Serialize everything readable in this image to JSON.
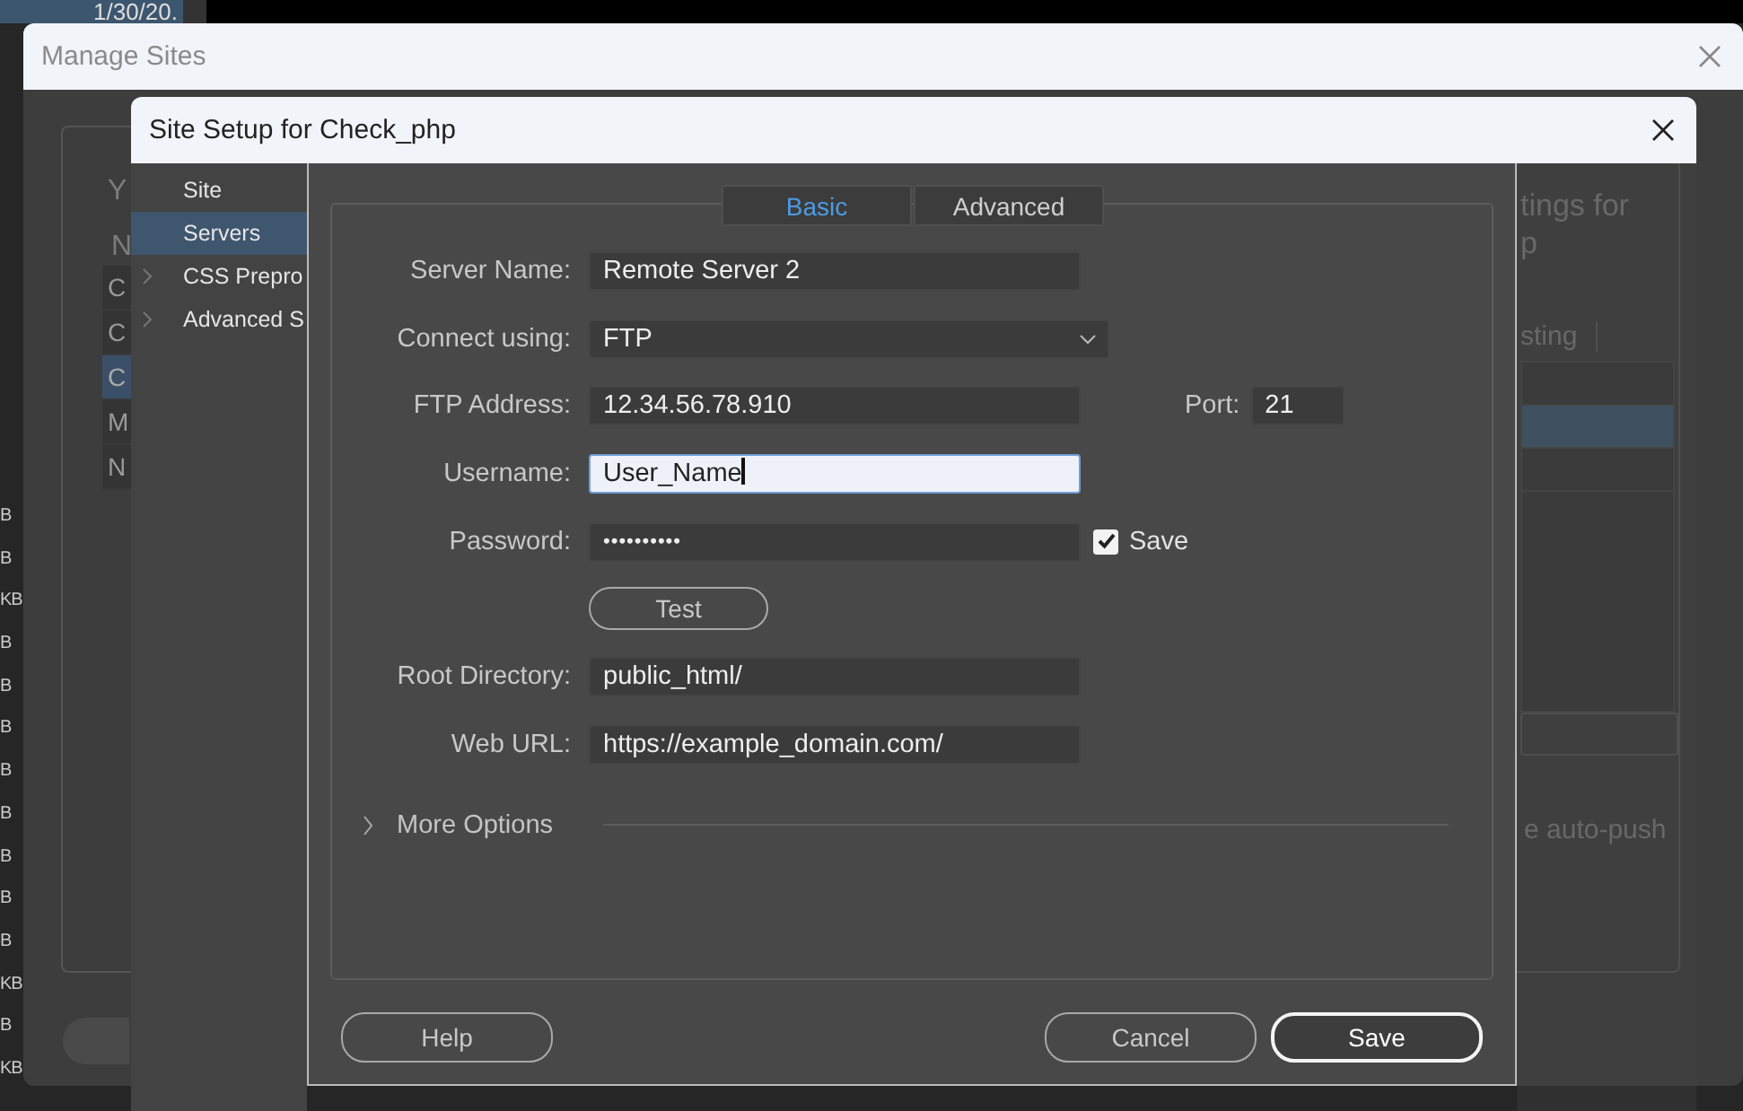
{
  "background": {
    "date_cell": "1/30/20.",
    "file_sizes": [
      "B",
      "B",
      "KB",
      "B",
      "B",
      "B",
      "B",
      "B",
      "B",
      "B",
      "B",
      "KB",
      "B",
      "KB"
    ]
  },
  "manage_sites": {
    "title": "Manage Sites",
    "heading_fragment": "Y",
    "column_fragment": "N",
    "site_list": [
      {
        "label": "C",
        "selected": false
      },
      {
        "label": "C",
        "selected": false
      },
      {
        "label": "C",
        "selected": true
      },
      {
        "label": "M",
        "selected": false
      },
      {
        "label": "N",
        "selected": false
      }
    ],
    "description_fragments": [
      "tings for",
      "p"
    ],
    "tab_fragment": "sting",
    "server_rows": [
      {
        "selected": false
      },
      {
        "selected": true
      },
      {
        "selected": false
      }
    ],
    "option_fragment": "e auto-push"
  },
  "site_setup": {
    "title": "Site Setup for Check_php",
    "sidebar": [
      {
        "label": "Site",
        "selected": false,
        "expandable": false
      },
      {
        "label": "Servers",
        "selected": true,
        "expandable": false
      },
      {
        "label": "CSS Prepro",
        "selected": false,
        "expandable": true
      },
      {
        "label": "Advanced S",
        "selected": false,
        "expandable": true
      }
    ],
    "tabs": [
      {
        "label": "Basic",
        "selected": true
      },
      {
        "label": "Advanced",
        "selected": false
      }
    ],
    "fields": [
      {
        "kind": "text",
        "label": "Server Name:",
        "value": "Remote Server 2",
        "focused": false
      },
      {
        "kind": "select",
        "label": "Connect using:",
        "value": "FTP"
      },
      {
        "kind": "text",
        "label": "FTP Address:",
        "value": "12.34.56.78.910",
        "focused": false,
        "port": {
          "label": "Port:",
          "value": "21"
        }
      },
      {
        "kind": "text",
        "label": "Username:",
        "value": "User_Name",
        "focused": true
      },
      {
        "kind": "password",
        "label": "Password:",
        "value": "••••••••••",
        "save": {
          "label": "Save",
          "checked": true
        }
      },
      {
        "kind": "button",
        "label": "Test"
      },
      {
        "kind": "text",
        "label": "Root Directory:",
        "value": "public_html/",
        "focused": false
      },
      {
        "kind": "text",
        "label": "Web URL:",
        "value": "https://example_domain.com/",
        "focused": false
      }
    ],
    "more_options": {
      "label": "More Options",
      "expanded": false
    },
    "buttons": [
      {
        "label": "Help",
        "primary": false
      },
      {
        "label": "Cancel",
        "primary": false
      },
      {
        "label": "Save",
        "primary": true
      }
    ]
  }
}
